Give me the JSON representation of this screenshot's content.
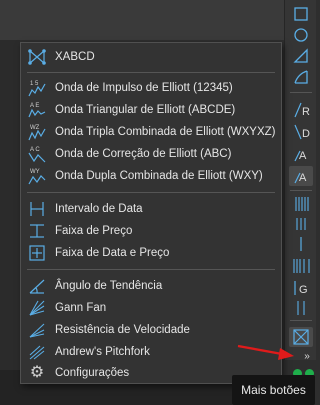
{
  "menu": {
    "items": [
      {
        "label": "XABCD",
        "icon": "xabcd-pattern-icon"
      },
      {
        "label": "Onda de Impulso de Elliott (12345)",
        "icon": "elliott-impulse-wave-icon"
      },
      {
        "label": "Onda Triangular de Elliott (ABCDE)",
        "icon": "elliott-triangle-wave-icon"
      },
      {
        "label": "Onda Tripla Combinada de Elliott (WXYXZ)",
        "icon": "elliott-triple-combo-wave-icon"
      },
      {
        "label": "Onda de Correção de Elliott (ABC)",
        "icon": "elliott-correction-wave-icon"
      },
      {
        "label": "Onda Dupla Combinada de Elliott (WXY)",
        "icon": "elliott-double-combo-wave-icon"
      },
      {
        "label": "Intervalo de Data",
        "icon": "date-range-icon"
      },
      {
        "label": "Faixa de Preço",
        "icon": "price-range-icon"
      },
      {
        "label": "Faixa de Data e Preço",
        "icon": "date-price-range-icon"
      },
      {
        "label": "Ângulo de Tendência",
        "icon": "trend-angle-icon"
      },
      {
        "label": "Gann Fan",
        "icon": "gann-fan-icon"
      },
      {
        "label": "Resistência de Velocidade",
        "icon": "speed-resistance-icon"
      },
      {
        "label": "Andrew's Pitchfork",
        "icon": "pitchfork-icon"
      },
      {
        "label": "Configurações",
        "icon": "gear-icon"
      }
    ]
  },
  "icon_texts": {
    "impulse": "1 5",
    "triangle": "A E",
    "triple": "WZ",
    "correction": "A C",
    "double": "WY"
  },
  "toolbar": {
    "letters": [
      "R",
      "D",
      "A",
      "A",
      "G"
    ],
    "more_glyph": "»"
  },
  "tooltip": {
    "text": "Mais botões"
  },
  "colors": {
    "accent": "#5aaee6",
    "arrow": "#e01b1b",
    "status_dot": "#1fae4b"
  }
}
